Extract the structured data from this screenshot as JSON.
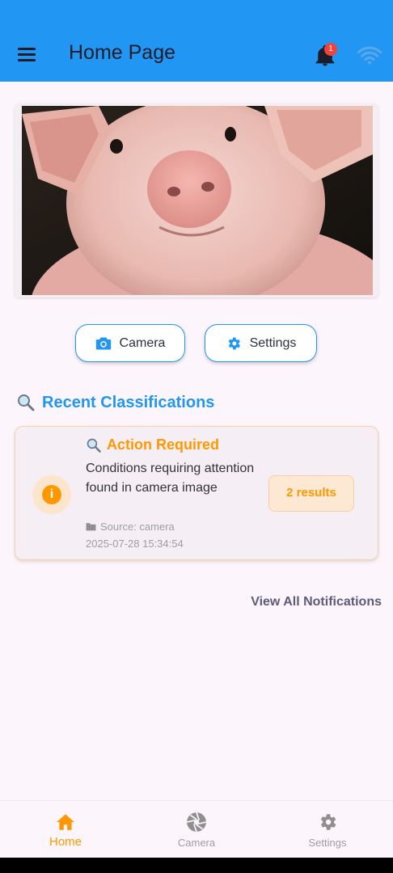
{
  "app_bar": {
    "title": "Home Page",
    "notification_count": "1",
    "icons": [
      "menu-icon",
      "bell-icon",
      "wifi-icon"
    ]
  },
  "hero": {
    "subject": "pig-photo"
  },
  "actions": {
    "camera_label": "Camera",
    "settings_label": "Settings"
  },
  "recent": {
    "title": "Recent Classifications",
    "card": {
      "title": "Action Required",
      "description": "Conditions requiring attention found in camera image",
      "source": "Source: camera",
      "timestamp": "2025-07-28 15:34:54",
      "results": "2 results"
    }
  },
  "view_all_label": "View All Notifications",
  "bottom_nav": {
    "items": [
      {
        "label": "Home",
        "icon": "home-icon",
        "active": true
      },
      {
        "label": "Camera",
        "icon": "aperture-icon",
        "active": false
      },
      {
        "label": "Settings",
        "icon": "gear-icon",
        "active": false
      }
    ]
  },
  "colors": {
    "primary": "#2196f3",
    "accent": "#ff9800",
    "badge": "#f44336",
    "background": "#fcf5fb"
  }
}
